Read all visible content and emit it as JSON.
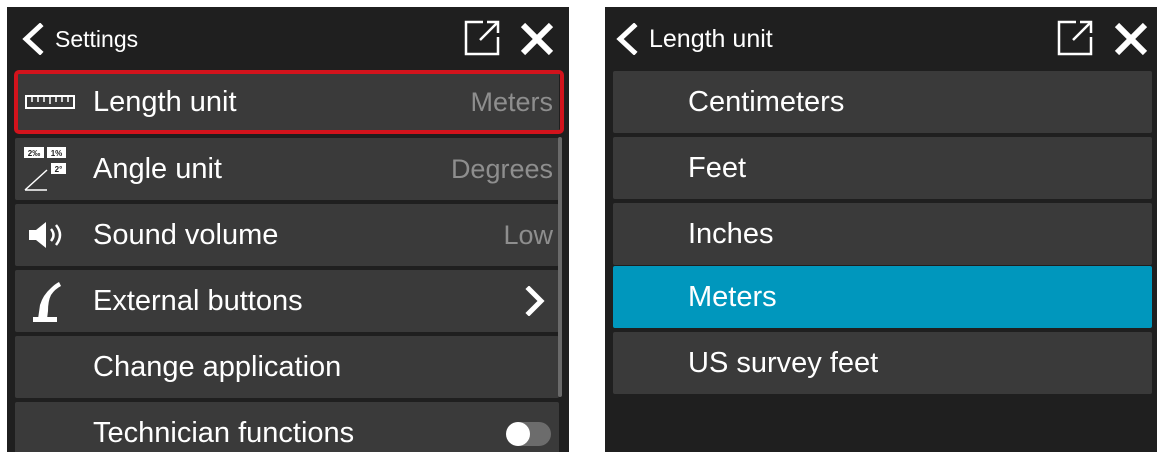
{
  "settings": {
    "header": {
      "title": "Settings",
      "back_icon": "chevron-left-icon",
      "popout_icon": "external-window-icon",
      "close_icon": "close-icon"
    },
    "items": [
      {
        "label": "Length unit",
        "value": "Meters",
        "icon": "ruler-icon",
        "selected": true
      },
      {
        "label": "Angle unit",
        "value": "Degrees",
        "icon": "slope-angle-icon"
      },
      {
        "label": "Sound volume",
        "value": "Low",
        "icon": "speaker-icon"
      },
      {
        "label": "External buttons",
        "value": "",
        "icon": "joystick-icon",
        "trailing_icon": "chevron-right-icon"
      },
      {
        "label": "Change application",
        "value": ""
      },
      {
        "label": "Technician functions",
        "value": "",
        "toggle": "off"
      }
    ],
    "angle_icon_badges": {
      "percent_mille": "2‰",
      "percent": "1%",
      "degree": "2°"
    }
  },
  "length_unit_dialog": {
    "header": {
      "title": "Length unit",
      "back_icon": "chevron-left-icon",
      "popout_icon": "external-window-icon",
      "close_icon": "close-icon"
    },
    "options": [
      {
        "label": "Centimeters",
        "selected": false
      },
      {
        "label": "Feet",
        "selected": false
      },
      {
        "label": "Inches",
        "selected": false
      },
      {
        "label": "Meters",
        "selected": true
      },
      {
        "label": "US survey feet",
        "selected": false
      }
    ],
    "selected_color": "#0097bd"
  },
  "colors": {
    "background": "#1f1f1f",
    "row": "#3a3a3a",
    "accent_red": "#d2131c",
    "accent_blue": "#0097bd",
    "value_text": "#8e8e8e"
  }
}
